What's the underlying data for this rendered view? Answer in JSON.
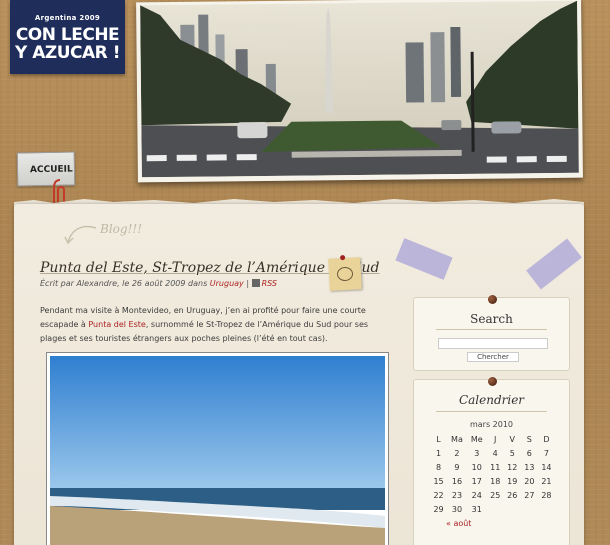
{
  "site": {
    "logo_sub": "Argentina 2009",
    "logo_line1": "CON LECHE",
    "logo_line2": "Y AZUCAR !"
  },
  "nav": {
    "home": "ACCUEIL"
  },
  "blog_label": "Blog!!!",
  "post": {
    "title": "Punta del Este, St-Tropez de l’Amérique du Sud",
    "meta_prefix": "Écrit par Alexandre, le 26 août 2009 dans",
    "category": "Uruguay",
    "separator": "|",
    "rss": "RSS",
    "body_part1": "Pendant ma visite à Montevideo, en Uruguay, j’en ai profité pour faire une courte escapade à",
    "body_link": "Punta del Este",
    "body_part2": ", surnommé le St-Tropez de l’Amérique du Sud pour ses plages et ses touristes étrangers aux poches pleines (l’été en tout cas)."
  },
  "sidebar": {
    "search": {
      "title": "Search",
      "button": "Chercher",
      "placeholder": ""
    },
    "calendar": {
      "title": "Calendrier",
      "month": "mars 2010",
      "days": [
        "L",
        "Ma",
        "Me",
        "J",
        "V",
        "S",
        "D"
      ],
      "weeks": [
        [
          "1",
          "2",
          "3",
          "4",
          "5",
          "6",
          "7"
        ],
        [
          "8",
          "9",
          "10",
          "11",
          "12",
          "13",
          "14"
        ],
        [
          "15",
          "16",
          "17",
          "18",
          "19",
          "20",
          "21"
        ],
        [
          "22",
          "23",
          "24",
          "25",
          "26",
          "27",
          "28"
        ],
        [
          "29",
          "30",
          "31",
          "",
          "",
          "",
          ""
        ]
      ],
      "prev": "« août"
    }
  },
  "colors": {
    "logo_bg": "#1e2d5a",
    "link": "#aa2222",
    "panel": "#f2ece0"
  }
}
